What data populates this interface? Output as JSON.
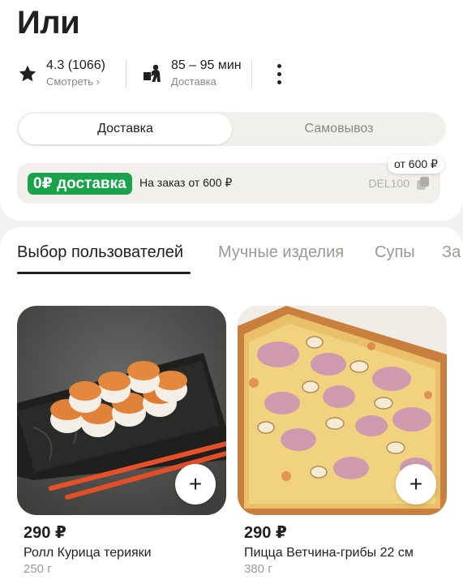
{
  "restaurant": {
    "title": "Или"
  },
  "info": {
    "rating_value": "4.3 (1066)",
    "rating_link": "Смотреть ›",
    "time_value": "85 – 95 мин",
    "time_label": "Доставка"
  },
  "mode_switch": {
    "active": "Доставка",
    "inactive": "Самовывоз"
  },
  "promo": {
    "badge": "0₽ доставка",
    "text": "На заказ от 600 ₽",
    "code": "DEL100",
    "tag": "от 600 ₽"
  },
  "categories": [
    "Выбор пользователей",
    "Мучные изделия",
    "Супы",
    "За"
  ],
  "products": [
    {
      "price": "290 ₽",
      "name": "Ролл Курица терияки",
      "weight": "250 г",
      "add": "+"
    },
    {
      "price": "290 ₽",
      "name": "Пицца Ветчина-грибы 22 см",
      "weight": "380 г",
      "add": "+"
    }
  ],
  "colors": {
    "accent_green": "#1aa34a",
    "text": "#21201f",
    "secondary": "#8a8784"
  },
  "icons": [
    "star-icon",
    "courier-icon",
    "more-vertical-icon",
    "copy-icon",
    "plus-icon"
  ]
}
